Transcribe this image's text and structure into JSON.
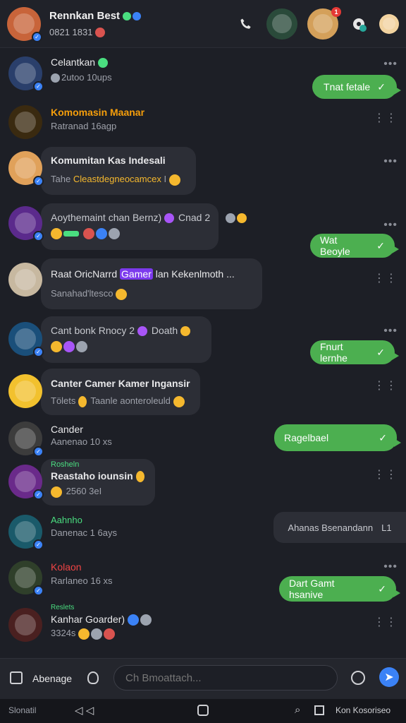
{
  "header": {
    "title": "Rennkan Best",
    "subtitle": "0821 1831",
    "phone_icon": "phone-icon",
    "settings_icon": "gear-icon",
    "notification_count": "1"
  },
  "chats": [
    {
      "name": "Celantkan",
      "meta": "2utoo 10ups",
      "message": "",
      "outgoing": "Tnat fetale"
    },
    {
      "name": "Komomasin Maanar",
      "meta": "Ratranad 16agp",
      "message": "",
      "outgoing": ""
    },
    {
      "name": "Komumitan Kas Indesali",
      "meta": "",
      "message_prefix": "Tahe",
      "message_highlight": "Cleastdegneocamcex",
      "message_suffix": "I",
      "outgoing": ""
    },
    {
      "name": "Aoythemaint chan Bernz)",
      "meta": "Cnad 2",
      "message": "",
      "outgoing": "Wat Beoyle"
    },
    {
      "name_prefix": "Raat OricNarrd",
      "name_highlight": "Gamer",
      "name_suffix": "lan Kekenlmoth ...",
      "meta": "Sanahad'ltesco",
      "outgoing": ""
    },
    {
      "name": "Cant bonk Rnocy 2",
      "meta_extra": "Doath",
      "outgoing": "Fnurt lernhe"
    },
    {
      "name": "Canter Camer Kamer Ingansir",
      "meta": "Tölets",
      "meta2": "Taanle aonteroleuld",
      "outgoing": ""
    },
    {
      "name": "Cander",
      "meta": "Aanenao 10 xs",
      "outgoing": "Ragelbael"
    },
    {
      "label": "Rosheln",
      "name": "Reastaho iounsin",
      "meta": "2560 3eI",
      "outgoing": ""
    },
    {
      "label": "Aahnho",
      "meta": "Danenac 1 6ays",
      "outgoing_gray": "Ahanas Bsenandann",
      "outgoing_gray_suffix": "L1"
    },
    {
      "name": "Kolaon",
      "meta": "Rarlaneo 16 xs",
      "outgoing": "Dart Gamt hsanive"
    },
    {
      "label": "Reslets",
      "name": "Kanhar Goarder)",
      "meta": "3324s",
      "outgoing": ""
    }
  ],
  "composer": {
    "label": "Abenage",
    "placeholder": "Ch Bmoattach...",
    "camera_icon": "camera-icon",
    "mic_icon": "mic-icon",
    "send_icon": "send-icon"
  },
  "navbar": {
    "left": "Slonatil",
    "right": "Kon Kosoriseo"
  },
  "colors": {
    "background": "#1d1f26",
    "bubble_out": "#4caf50",
    "bubble_in": "#2c2e36",
    "accent_orange": "#f59e0b",
    "accent_purple": "#7c3aed"
  }
}
